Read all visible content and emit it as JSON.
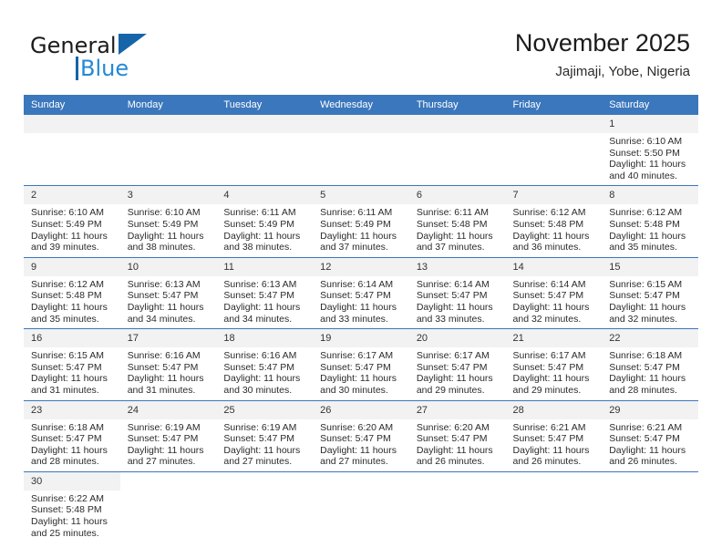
{
  "brand": {
    "name_top": "General",
    "name_bottom": "Blue",
    "accent_color": "#2389d6",
    "accent_dark": "#1565a8"
  },
  "header": {
    "title": "November 2025",
    "subtitle": "Jajimaji, Yobe, Nigeria"
  },
  "theme": {
    "header_row_bg": "#3b77bc",
    "daynum_bg": "#f2f2f2",
    "row_border": "#3b77bc",
    "text": "#2b2b2b"
  },
  "calendar": {
    "weekday_headers": [
      "Sunday",
      "Monday",
      "Tuesday",
      "Wednesday",
      "Thursday",
      "Friday",
      "Saturday"
    ],
    "labels": {
      "sunrise": "Sunrise:",
      "sunset": "Sunset:",
      "daylight": "Daylight:"
    },
    "weeks": [
      [
        {
          "day": "",
          "blank": true
        },
        {
          "day": "",
          "blank": true
        },
        {
          "day": "",
          "blank": true
        },
        {
          "day": "",
          "blank": true
        },
        {
          "day": "",
          "blank": true
        },
        {
          "day": "",
          "blank": true
        },
        {
          "day": "1",
          "sunrise": "Sunrise: 6:10 AM",
          "sunset": "Sunset: 5:50 PM",
          "daylight": "Daylight: 11 hours and 40 minutes."
        }
      ],
      [
        {
          "day": "2",
          "sunrise": "Sunrise: 6:10 AM",
          "sunset": "Sunset: 5:49 PM",
          "daylight": "Daylight: 11 hours and 39 minutes."
        },
        {
          "day": "3",
          "sunrise": "Sunrise: 6:10 AM",
          "sunset": "Sunset: 5:49 PM",
          "daylight": "Daylight: 11 hours and 38 minutes."
        },
        {
          "day": "4",
          "sunrise": "Sunrise: 6:11 AM",
          "sunset": "Sunset: 5:49 PM",
          "daylight": "Daylight: 11 hours and 38 minutes."
        },
        {
          "day": "5",
          "sunrise": "Sunrise: 6:11 AM",
          "sunset": "Sunset: 5:49 PM",
          "daylight": "Daylight: 11 hours and 37 minutes."
        },
        {
          "day": "6",
          "sunrise": "Sunrise: 6:11 AM",
          "sunset": "Sunset: 5:48 PM",
          "daylight": "Daylight: 11 hours and 37 minutes."
        },
        {
          "day": "7",
          "sunrise": "Sunrise: 6:12 AM",
          "sunset": "Sunset: 5:48 PM",
          "daylight": "Daylight: 11 hours and 36 minutes."
        },
        {
          "day": "8",
          "sunrise": "Sunrise: 6:12 AM",
          "sunset": "Sunset: 5:48 PM",
          "daylight": "Daylight: 11 hours and 35 minutes."
        }
      ],
      [
        {
          "day": "9",
          "sunrise": "Sunrise: 6:12 AM",
          "sunset": "Sunset: 5:48 PM",
          "daylight": "Daylight: 11 hours and 35 minutes."
        },
        {
          "day": "10",
          "sunrise": "Sunrise: 6:13 AM",
          "sunset": "Sunset: 5:47 PM",
          "daylight": "Daylight: 11 hours and 34 minutes."
        },
        {
          "day": "11",
          "sunrise": "Sunrise: 6:13 AM",
          "sunset": "Sunset: 5:47 PM",
          "daylight": "Daylight: 11 hours and 34 minutes."
        },
        {
          "day": "12",
          "sunrise": "Sunrise: 6:14 AM",
          "sunset": "Sunset: 5:47 PM",
          "daylight": "Daylight: 11 hours and 33 minutes."
        },
        {
          "day": "13",
          "sunrise": "Sunrise: 6:14 AM",
          "sunset": "Sunset: 5:47 PM",
          "daylight": "Daylight: 11 hours and 33 minutes."
        },
        {
          "day": "14",
          "sunrise": "Sunrise: 6:14 AM",
          "sunset": "Sunset: 5:47 PM",
          "daylight": "Daylight: 11 hours and 32 minutes."
        },
        {
          "day": "15",
          "sunrise": "Sunrise: 6:15 AM",
          "sunset": "Sunset: 5:47 PM",
          "daylight": "Daylight: 11 hours and 32 minutes."
        }
      ],
      [
        {
          "day": "16",
          "sunrise": "Sunrise: 6:15 AM",
          "sunset": "Sunset: 5:47 PM",
          "daylight": "Daylight: 11 hours and 31 minutes."
        },
        {
          "day": "17",
          "sunrise": "Sunrise: 6:16 AM",
          "sunset": "Sunset: 5:47 PM",
          "daylight": "Daylight: 11 hours and 31 minutes."
        },
        {
          "day": "18",
          "sunrise": "Sunrise: 6:16 AM",
          "sunset": "Sunset: 5:47 PM",
          "daylight": "Daylight: 11 hours and 30 minutes."
        },
        {
          "day": "19",
          "sunrise": "Sunrise: 6:17 AM",
          "sunset": "Sunset: 5:47 PM",
          "daylight": "Daylight: 11 hours and 30 minutes."
        },
        {
          "day": "20",
          "sunrise": "Sunrise: 6:17 AM",
          "sunset": "Sunset: 5:47 PM",
          "daylight": "Daylight: 11 hours and 29 minutes."
        },
        {
          "day": "21",
          "sunrise": "Sunrise: 6:17 AM",
          "sunset": "Sunset: 5:47 PM",
          "daylight": "Daylight: 11 hours and 29 minutes."
        },
        {
          "day": "22",
          "sunrise": "Sunrise: 6:18 AM",
          "sunset": "Sunset: 5:47 PM",
          "daylight": "Daylight: 11 hours and 28 minutes."
        }
      ],
      [
        {
          "day": "23",
          "sunrise": "Sunrise: 6:18 AM",
          "sunset": "Sunset: 5:47 PM",
          "daylight": "Daylight: 11 hours and 28 minutes."
        },
        {
          "day": "24",
          "sunrise": "Sunrise: 6:19 AM",
          "sunset": "Sunset: 5:47 PM",
          "daylight": "Daylight: 11 hours and 27 minutes."
        },
        {
          "day": "25",
          "sunrise": "Sunrise: 6:19 AM",
          "sunset": "Sunset: 5:47 PM",
          "daylight": "Daylight: 11 hours and 27 minutes."
        },
        {
          "day": "26",
          "sunrise": "Sunrise: 6:20 AM",
          "sunset": "Sunset: 5:47 PM",
          "daylight": "Daylight: 11 hours and 27 minutes."
        },
        {
          "day": "27",
          "sunrise": "Sunrise: 6:20 AM",
          "sunset": "Sunset: 5:47 PM",
          "daylight": "Daylight: 11 hours and 26 minutes."
        },
        {
          "day": "28",
          "sunrise": "Sunrise: 6:21 AM",
          "sunset": "Sunset: 5:47 PM",
          "daylight": "Daylight: 11 hours and 26 minutes."
        },
        {
          "day": "29",
          "sunrise": "Sunrise: 6:21 AM",
          "sunset": "Sunset: 5:47 PM",
          "daylight": "Daylight: 11 hours and 26 minutes."
        }
      ],
      [
        {
          "day": "30",
          "sunrise": "Sunrise: 6:22 AM",
          "sunset": "Sunset: 5:48 PM",
          "daylight": "Daylight: 11 hours and 25 minutes."
        },
        {
          "day": "",
          "blank": true
        },
        {
          "day": "",
          "blank": true
        },
        {
          "day": "",
          "blank": true
        },
        {
          "day": "",
          "blank": true
        },
        {
          "day": "",
          "blank": true
        },
        {
          "day": "",
          "blank": true
        }
      ]
    ]
  }
}
